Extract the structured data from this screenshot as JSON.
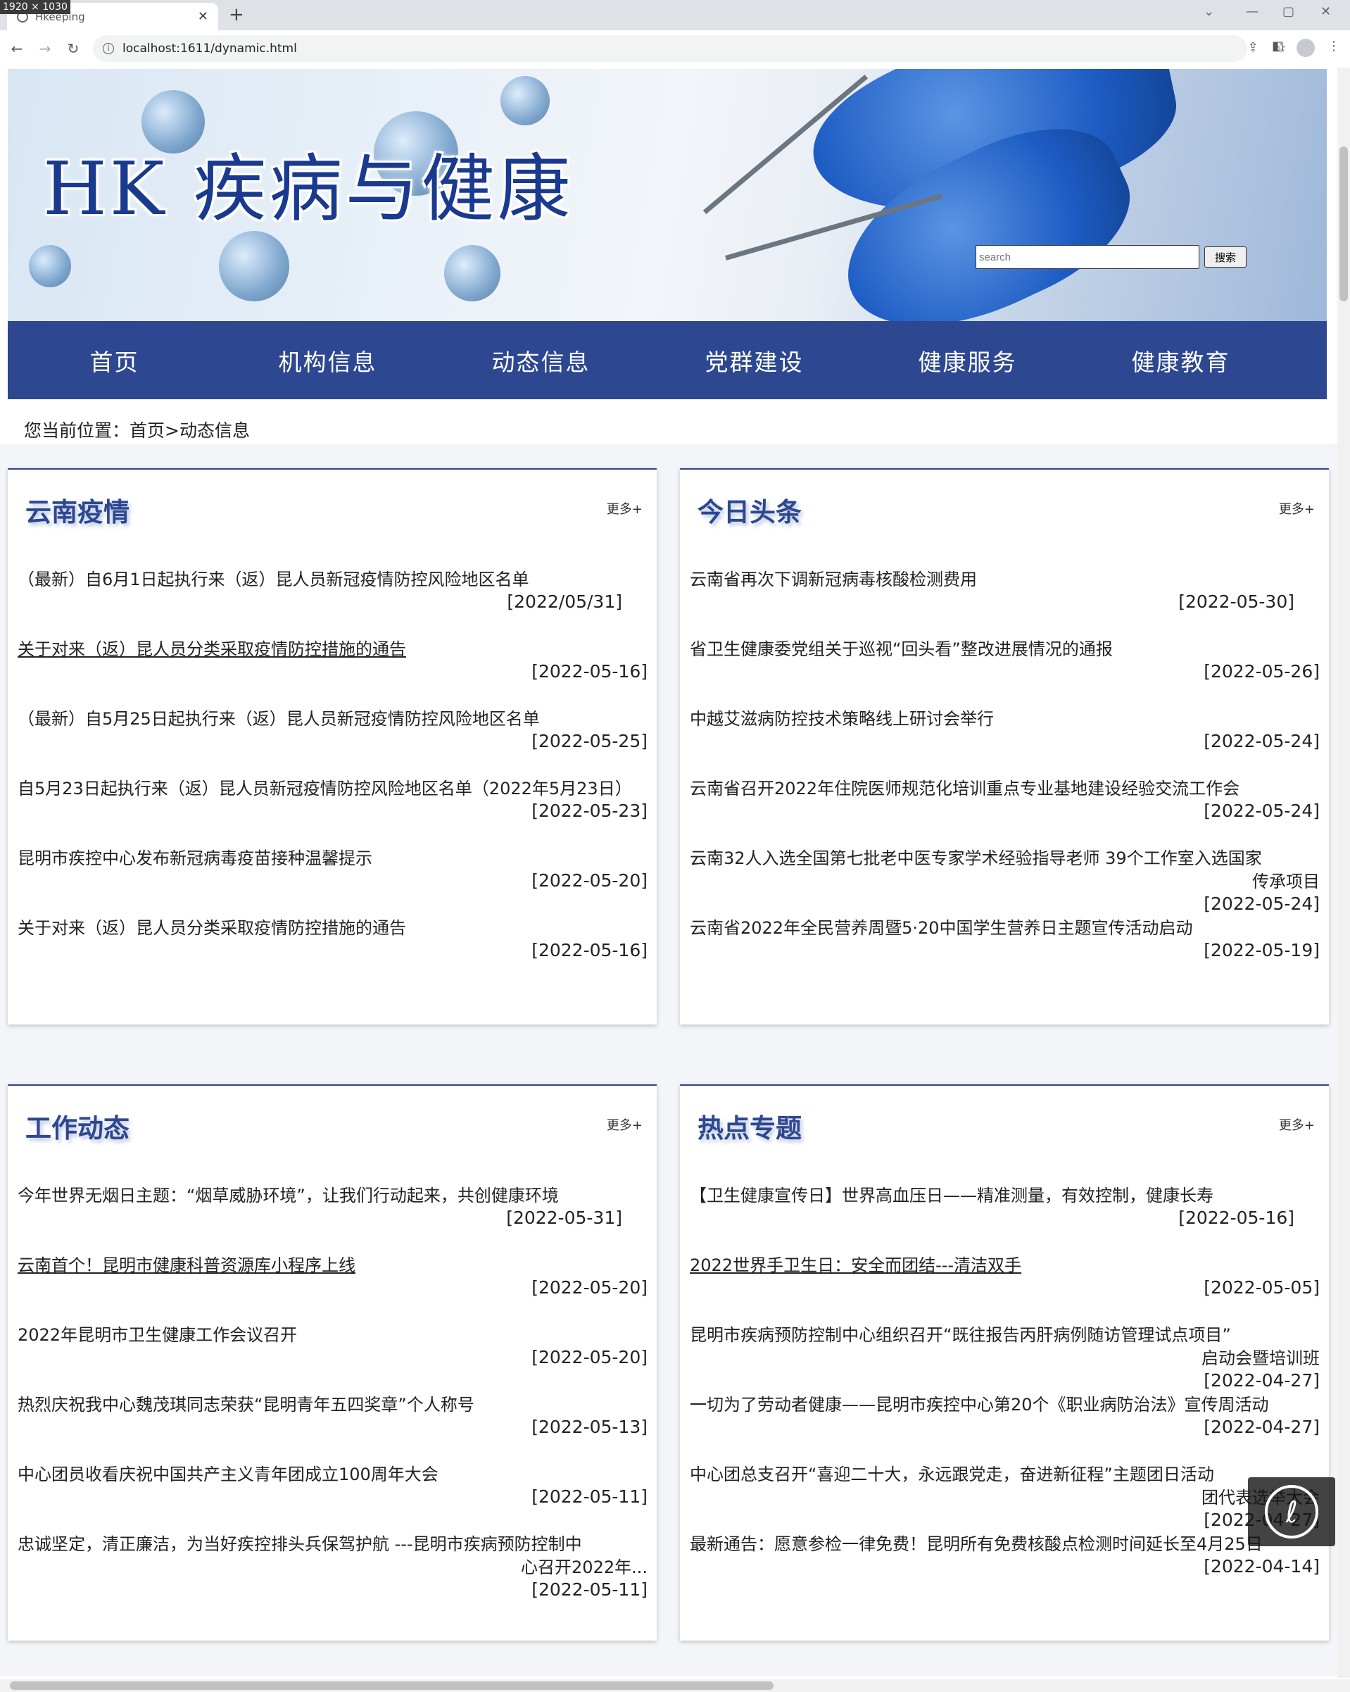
{
  "browser": {
    "size_badge": "1920 × 1030",
    "tab_title": "Hkeeping",
    "url": "localhost:1611/dynamic.html"
  },
  "banner": {
    "title": "HK 疾病与健康",
    "search_placeholder": "search",
    "search_button": "搜索"
  },
  "nav": [
    "首页",
    "机构信息",
    "动态信息",
    "党群建设",
    "健康服务",
    "健康教育"
  ],
  "breadcrumb": "您当前位置：首页>动态信息",
  "panels": [
    {
      "title": "云南疫情",
      "more": "更多+",
      "items": [
        {
          "title": "（最新）自6月1日起执行来（返）昆人员新冠疫情防控风险地区名单",
          "date": "[2022/05/31]",
          "underline": false,
          "dateOffset": true
        },
        {
          "title": "关于对来（返）昆人员分类采取疫情防控措施的通告",
          "date": "[2022-05-16]",
          "underline": true
        },
        {
          "title": "（最新）自5月25日起执行来（返）昆人员新冠疫情防控风险地区名单",
          "date": "[2022-05-25]",
          "underline": false
        },
        {
          "title": "自5月23日起执行来（返）昆人员新冠疫情防控风险地区名单（2022年5月23日）",
          "date": "[2022-05-23]",
          "underline": false
        },
        {
          "title": "昆明市疾控中心发布新冠病毒疫苗接种温馨提示",
          "date": "[2022-05-20]",
          "underline": false
        },
        {
          "title": "关于对来（返）昆人员分类采取疫情防控措施的通告",
          "date": "[2022-05-16]",
          "underline": false
        }
      ]
    },
    {
      "title": "今日头条",
      "more": "更多+",
      "items": [
        {
          "title": "云南省再次下调新冠病毒核酸检测费用",
          "date": "[2022-05-30]",
          "underline": false,
          "dateOffset": true
        },
        {
          "title": "省卫生健康委党组关于巡视“回头看”整改进展情况的通报",
          "date": "[2022-05-26]",
          "underline": false
        },
        {
          "title": "中越艾滋病防控技术策略线上研讨会举行",
          "date": "[2022-05-24]",
          "underline": false
        },
        {
          "title": "云南省召开2022年住院医师规范化培训重点专业基地建设经验交流工作会",
          "date": "[2022-05-24]",
          "underline": false
        },
        {
          "title": "云南32人入选全国第七批老中医专家学术经验指导老师 39个工作室入选国家",
          "title2": "传承项目",
          "date": "[2022-05-24]",
          "underline": false
        },
        {
          "title": "云南省2022年全民营养周暨5·20中国学生营养日主题宣传活动启动",
          "date": "[2022-05-19]",
          "underline": false
        }
      ]
    },
    {
      "title": "工作动态",
      "more": "更多+",
      "items": [
        {
          "title": "今年世界无烟日主题：“烟草威胁环境”，让我们行动起来，共创健康环境",
          "date": "[2022-05-31]",
          "underline": false,
          "dateOffset": true
        },
        {
          "title": "云南首个！昆明市健康科普资源库小程序上线",
          "date": "[2022-05-20]",
          "underline": true
        },
        {
          "title": "2022年昆明市卫生健康工作会议召开",
          "date": "[2022-05-20]",
          "underline": false
        },
        {
          "title": "热烈庆祝我中心魏茂琪同志荣获“昆明青年五四奖章”个人称号",
          "date": "[2022-05-13]",
          "underline": false
        },
        {
          "title": "中心团员收看庆祝中国共产主义青年团成立100周年大会",
          "date": "[2022-05-11]",
          "underline": false
        },
        {
          "title": "忠诚坚定，清正廉洁，为当好疾控排头兵保驾护航 ---昆明市疾病预防控制中",
          "title2": "心召开2022年...",
          "date": "[2022-05-11]",
          "underline": false
        }
      ]
    },
    {
      "title": "热点专题",
      "more": "更多+",
      "items": [
        {
          "title": "【卫生健康宣传日】世界高血压日——精准测量，有效控制，健康长寿",
          "date": "[2022-05-16]",
          "underline": false,
          "dateOffset": true
        },
        {
          "title": "2022世界手卫生日：安全而团结---清洁双手",
          "date": "[2022-05-05]",
          "underline": true
        },
        {
          "title": "昆明市疾病预防控制中心组织召开“既往报告丙肝病例随访管理试点项目”",
          "title2": "启动会暨培训班",
          "date": "[2022-04-27]",
          "underline": false
        },
        {
          "title": "一切为了劳动者健康——昆明市疾控中心第20个《职业病防治法》宣传周活动",
          "date": "[2022-04-27]",
          "underline": false
        },
        {
          "title": "中心团总支召开“喜迎二十大，永远跟党走，奋进新征程”主题团日活动",
          "title2": "团代表选举大会",
          "date": "[2022-04-27]",
          "underline": false
        },
        {
          "title": "最新通告：愿意参检一律免费！昆明所有免费核酸点检测时间延长至4月25日",
          "date": "[2022-04-14]",
          "underline": false
        }
      ]
    }
  ]
}
